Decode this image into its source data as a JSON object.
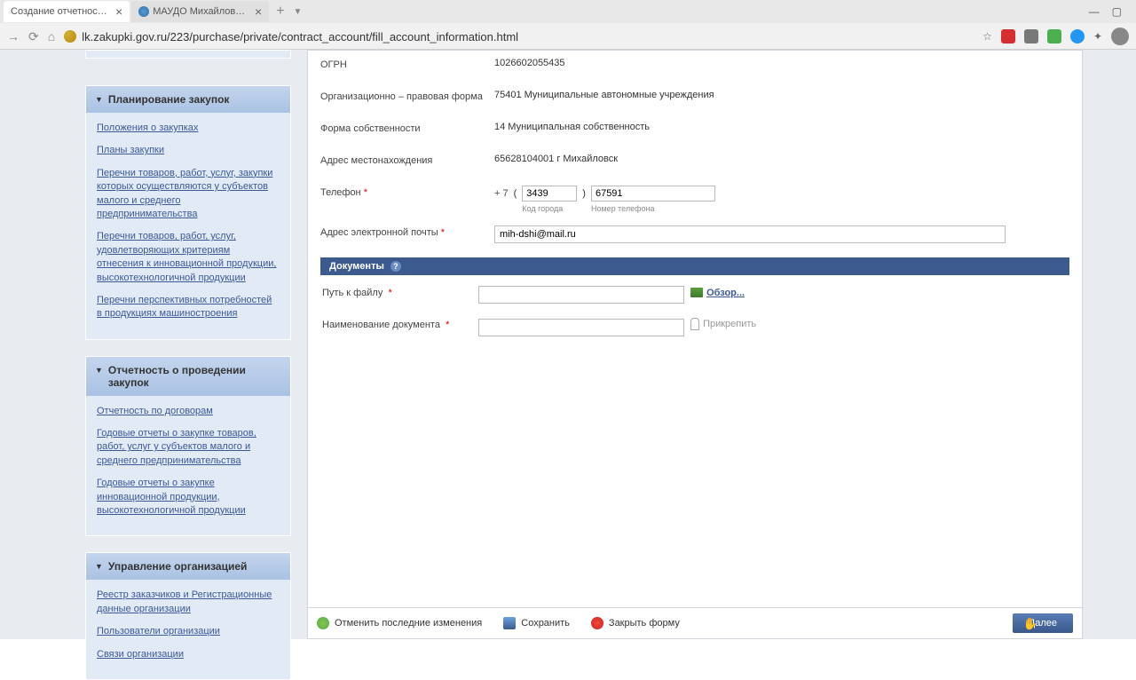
{
  "browser": {
    "tabs": [
      {
        "title": "Создание отчетности по",
        "active": true
      },
      {
        "title": "МАУДО Михайловская",
        "active": false
      }
    ],
    "url": "lk.zakupki.gov.ru/223/purchase/private/contract_account/fill_account_information.html"
  },
  "sidebar": {
    "sections": [
      {
        "title": "Планирование закупок",
        "links": [
          "Положения о закупках",
          "Планы закупки",
          "Перечни товаров, работ, услуг, закупки которых осуществляются у субъектов малого и среднего предпринимательства",
          "Перечни товаров, работ, услуг, удовлетворяющих критериям отнесения к инновационной продукции, высокотехнологичной продукции",
          "Перечни перспективных потребностей в продукциях машиностроения"
        ]
      },
      {
        "title": "Отчетность о проведении закупок",
        "links": [
          "Отчетность по договорам",
          "Годовые отчеты о закупке товаров, работ, услуг у субъектов малого и среднего предпринимательства",
          "Годовые отчеты о закупке инновационной продукции, высокотехнологичной продукции"
        ]
      },
      {
        "title": "Управление организацией",
        "links": [
          "Реестр заказчиков и Регистрационные данные организации",
          "Пользователи организации",
          "Связи организации"
        ]
      }
    ]
  },
  "form": {
    "ogrn_label": "ОГРН",
    "ogrn_value": "1026602055435",
    "opf_label": "Организационно – правовая форма",
    "opf_value": "75401 Муниципальные автономные учреждения",
    "ownership_label": "Форма собственности",
    "ownership_value": "14 Муниципальная собственность",
    "address_label": "Адрес местонахождения",
    "address_value": "65628104001 г Михайловск",
    "phone_label": "Телефон",
    "phone_prefix": "+ 7",
    "phone_code": "3439",
    "phone_num": "67591",
    "phone_code_hint": "Код города",
    "phone_num_hint": "Номер телефона",
    "email_label": "Адрес электронной почты",
    "email_value": "mih-dshi@mail.ru",
    "docs_header": "Документы",
    "file_path_label": "Путь к файлу",
    "browse_label": "Обзор...",
    "doc_name_label": "Наименование документа",
    "attach_label": "Прикрепить"
  },
  "actions": {
    "undo": "Отменить последние изменения",
    "save": "Сохранить",
    "close": "Закрыть форму",
    "next": "Далее"
  }
}
